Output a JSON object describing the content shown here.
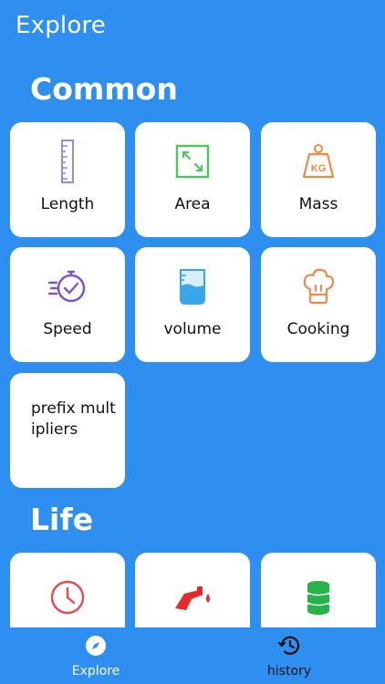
{
  "header": {
    "title": "Explore"
  },
  "sections": [
    {
      "title": "Common",
      "cards": [
        {
          "label": "Length",
          "icon": "ruler-icon"
        },
        {
          "label": "Area",
          "icon": "area-icon"
        },
        {
          "label": "Mass",
          "icon": "weight-icon"
        },
        {
          "label": "Speed",
          "icon": "stopwatch-icon"
        },
        {
          "label": "volume",
          "icon": "beaker-icon"
        },
        {
          "label": "Cooking",
          "icon": "chef-hat-icon"
        },
        {
          "label": "prefix multipliers",
          "icon": ""
        }
      ]
    },
    {
      "title": "Life",
      "cards": [
        {
          "label": "",
          "icon": "clock-icon"
        },
        {
          "label": "",
          "icon": "fuel-nozzle-icon"
        },
        {
          "label": "",
          "icon": "database-icon"
        }
      ]
    }
  ],
  "nav": [
    {
      "label": "Explore",
      "icon": "compass-icon",
      "active": true
    },
    {
      "label": "history",
      "icon": "history-icon",
      "active": false
    }
  ],
  "colors": {
    "background": "#2f8ff0",
    "card": "#ffffff",
    "nav_active": "#ffffff",
    "nav_inactive": "#111111"
  }
}
